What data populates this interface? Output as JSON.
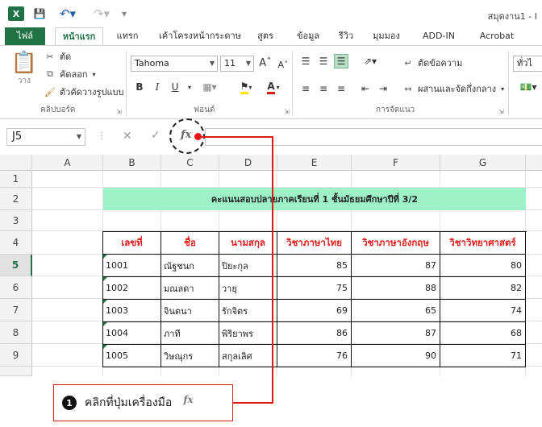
{
  "titlebar": {
    "app_logo": "X",
    "title": "สมุดงาน1 - I",
    "undo_icon": "undo-icon",
    "redo_icon": "redo-icon"
  },
  "tabs": [
    {
      "label": "ไฟล์"
    },
    {
      "label": "หน้าแรก"
    },
    {
      "label": "แทรก"
    },
    {
      "label": "เค้าโครงหน้ากระดาษ"
    },
    {
      "label": "สูตร"
    },
    {
      "label": "ข้อมูล"
    },
    {
      "label": "รีวิว"
    },
    {
      "label": "มุมมอง"
    },
    {
      "label": "ADD-IN"
    },
    {
      "label": "Acrobat"
    }
  ],
  "ribbon": {
    "clipboard": {
      "paste_label": "วาง",
      "cut_label": "ตัด",
      "copy_label": "คัดลอก",
      "format_painter_label": "ตัวคัดวางรูปแบบ",
      "group_label": "คลิปบอร์ด"
    },
    "font": {
      "font_name": "Tahoma",
      "font_size": "11",
      "bold": "B",
      "italic": "I",
      "underline": "U",
      "font_color_label": "A",
      "group_label": "ฟอนต์"
    },
    "alignment": {
      "wrap_label": "ตัดข้อความ",
      "merge_label": "ผสานและจัดกึ่งกลาง",
      "group_label": "การจัดแนว"
    },
    "number": {
      "format_label": "ทั่วไ"
    }
  },
  "formula_bar": {
    "name_box": "J5",
    "cancel": "✕",
    "enter": "✓",
    "fx": "fx",
    "value": ""
  },
  "columns": [
    "A",
    "B",
    "C",
    "D",
    "E",
    "F",
    "G"
  ],
  "rows": [
    "1",
    "2",
    "3",
    "4",
    "5",
    "6",
    "7",
    "8",
    "9"
  ],
  "sheet": {
    "banner": "คะแนนสอบปลายภาคเรียนที่ 1 ชั้นมัธยมศึกษาปีที่ 3/2",
    "headers": [
      "เลขที่",
      "ชื่อ",
      "นามสกุล",
      "วิชาภาษาไทย",
      "วิชาภาษาอังกฤษ",
      "วิชาวิทยาศาสตร์"
    ],
    "records": [
      [
        "1001",
        "ณัฐชนก",
        "ปิยะกุล",
        "85",
        "87",
        "80"
      ],
      [
        "1002",
        "มณลดา",
        "วายุ",
        "75",
        "88",
        "82"
      ],
      [
        "1003",
        "จินตนา",
        "รักจิตร",
        "69",
        "65",
        "74"
      ],
      [
        "1004",
        "ภาที",
        "พิริยาพร",
        "86",
        "87",
        "68"
      ],
      [
        "1005",
        "วิษณุกร",
        "สกุลเลิศ",
        "76",
        "90",
        "71"
      ]
    ]
  },
  "callout": {
    "number": "1",
    "text": "คลิกที่ปุ่มเครื่องมือ",
    "icon_label": "fx"
  }
}
